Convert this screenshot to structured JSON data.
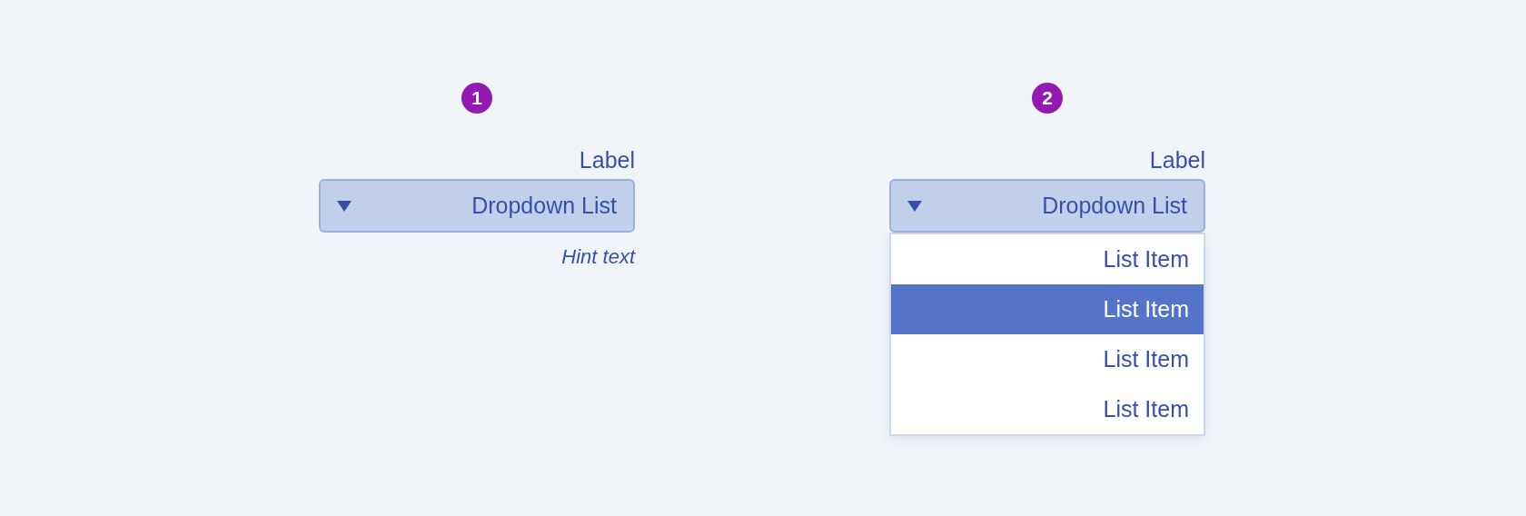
{
  "dropdowns": [
    {
      "badge": "1",
      "label": "Label",
      "value": "Dropdown List",
      "hint": "Hint text"
    },
    {
      "badge": "2",
      "label": "Label",
      "value": "Dropdown List",
      "expanded": true,
      "items": [
        {
          "text": "List Item",
          "selected": false
        },
        {
          "text": "List Item",
          "selected": true
        },
        {
          "text": "List Item",
          "selected": false
        },
        {
          "text": "List Item",
          "selected": false
        }
      ]
    }
  ]
}
